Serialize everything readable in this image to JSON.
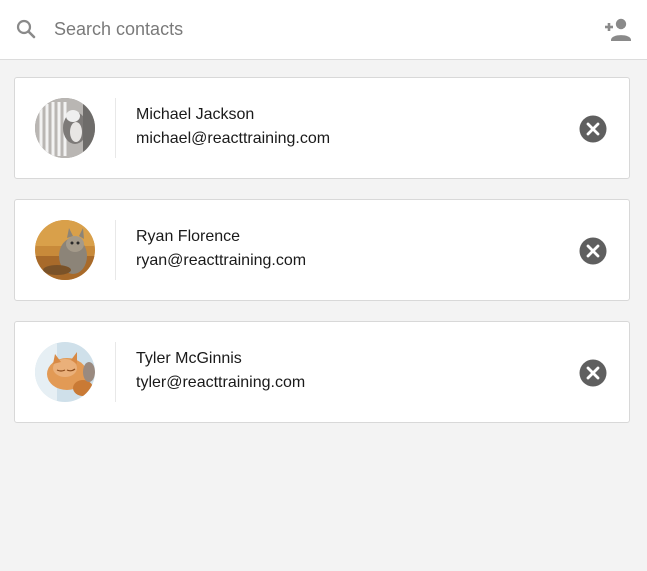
{
  "search": {
    "placeholder": "Search contacts",
    "value": "",
    "icon": "search-icon"
  },
  "toolbar": {
    "add_contact_icon": "person-add-icon"
  },
  "contacts": [
    {
      "name": "Michael Jackson",
      "email": "michael@reacttraining.com",
      "avatar": "cat photo (gray cat behind radiator)"
    },
    {
      "name": "Ryan Florence",
      "email": "ryan@reacttraining.com",
      "avatar": "cat photo (tabby kitten)"
    },
    {
      "name": "Tyler McGinnis",
      "email": "tyler@reacttraining.com",
      "avatar": "cat photo (orange kitten sleeping)"
    }
  ],
  "colors": {
    "background": "#f3f3f3",
    "card": "#ffffff",
    "icon_gray": "#8a8a8a",
    "remove_button": "#5f5f5f",
    "text": "#1a1a1a"
  }
}
